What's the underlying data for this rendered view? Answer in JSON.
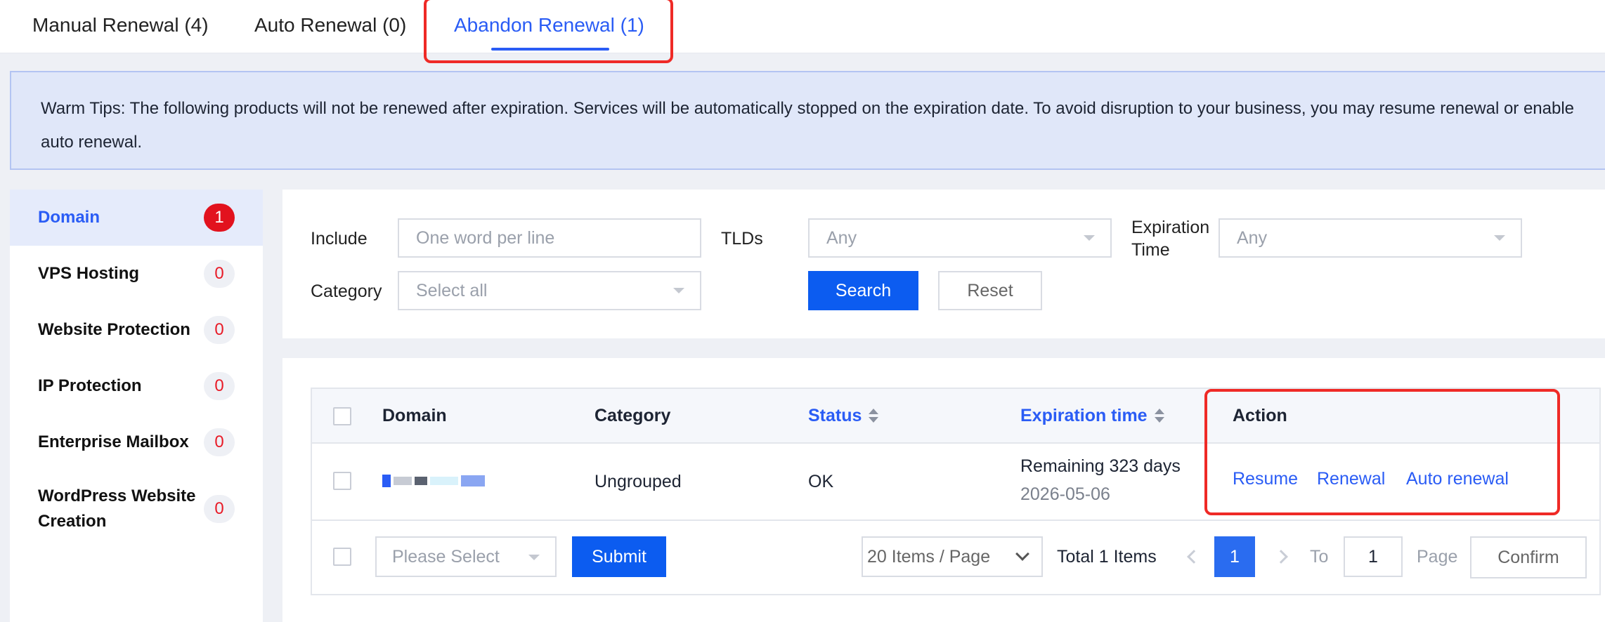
{
  "tabs": [
    {
      "label": "Manual Renewal (4)",
      "active": false
    },
    {
      "label": "Auto Renewal (0)",
      "active": false
    },
    {
      "label": "Abandon Renewal (1)",
      "active": true
    }
  ],
  "tip": {
    "text": "Warm Tips: The following products will not be renewed after expiration. Services will be automatically stopped on the expiration date. To avoid disruption to your business, you may resume renewal or enable auto renewal."
  },
  "sidebar": {
    "items": [
      {
        "label": "Domain",
        "count": "1",
        "active": true
      },
      {
        "label": "VPS Hosting",
        "count": "0"
      },
      {
        "label": "Website Protection",
        "count": "0"
      },
      {
        "label": "IP Protection",
        "count": "0"
      },
      {
        "label": "Enterprise Mailbox",
        "count": "0"
      },
      {
        "label": "WordPress Website Creation",
        "count": "0"
      }
    ]
  },
  "filter": {
    "include_label": "Include",
    "include_placeholder": "One word per line",
    "tlds_label": "TLDs",
    "tlds_value": "Any",
    "expiration_label": "Expiration Time",
    "expiration_value": "Any",
    "category_label": "Category",
    "category_value": "Select all",
    "search_label": "Search",
    "reset_label": "Reset"
  },
  "table": {
    "columns": {
      "domain": "Domain",
      "category": "Category",
      "status": "Status",
      "expiration": "Expiration time",
      "action": "Action"
    },
    "rows": [
      {
        "category": "Ungrouped",
        "status": "OK",
        "remaining": "Remaining 323 days",
        "date": "2026-05-06",
        "actions": [
          "Resume",
          "Renewal",
          "Auto renewal"
        ]
      }
    ]
  },
  "footer": {
    "bulk_placeholder": "Please Select",
    "submit_label": "Submit",
    "page_size": "20 Items / Page",
    "total": "Total 1 Items",
    "current_page": "1",
    "to_label": "To",
    "goto_value": "1",
    "page_label": "Page",
    "confirm_label": "Confirm"
  },
  "colors": {
    "accent": "#2a5cf5",
    "primary_button": "#0c5cf0",
    "highlight": "#ef2a26",
    "badge_red": "#e2121e"
  }
}
